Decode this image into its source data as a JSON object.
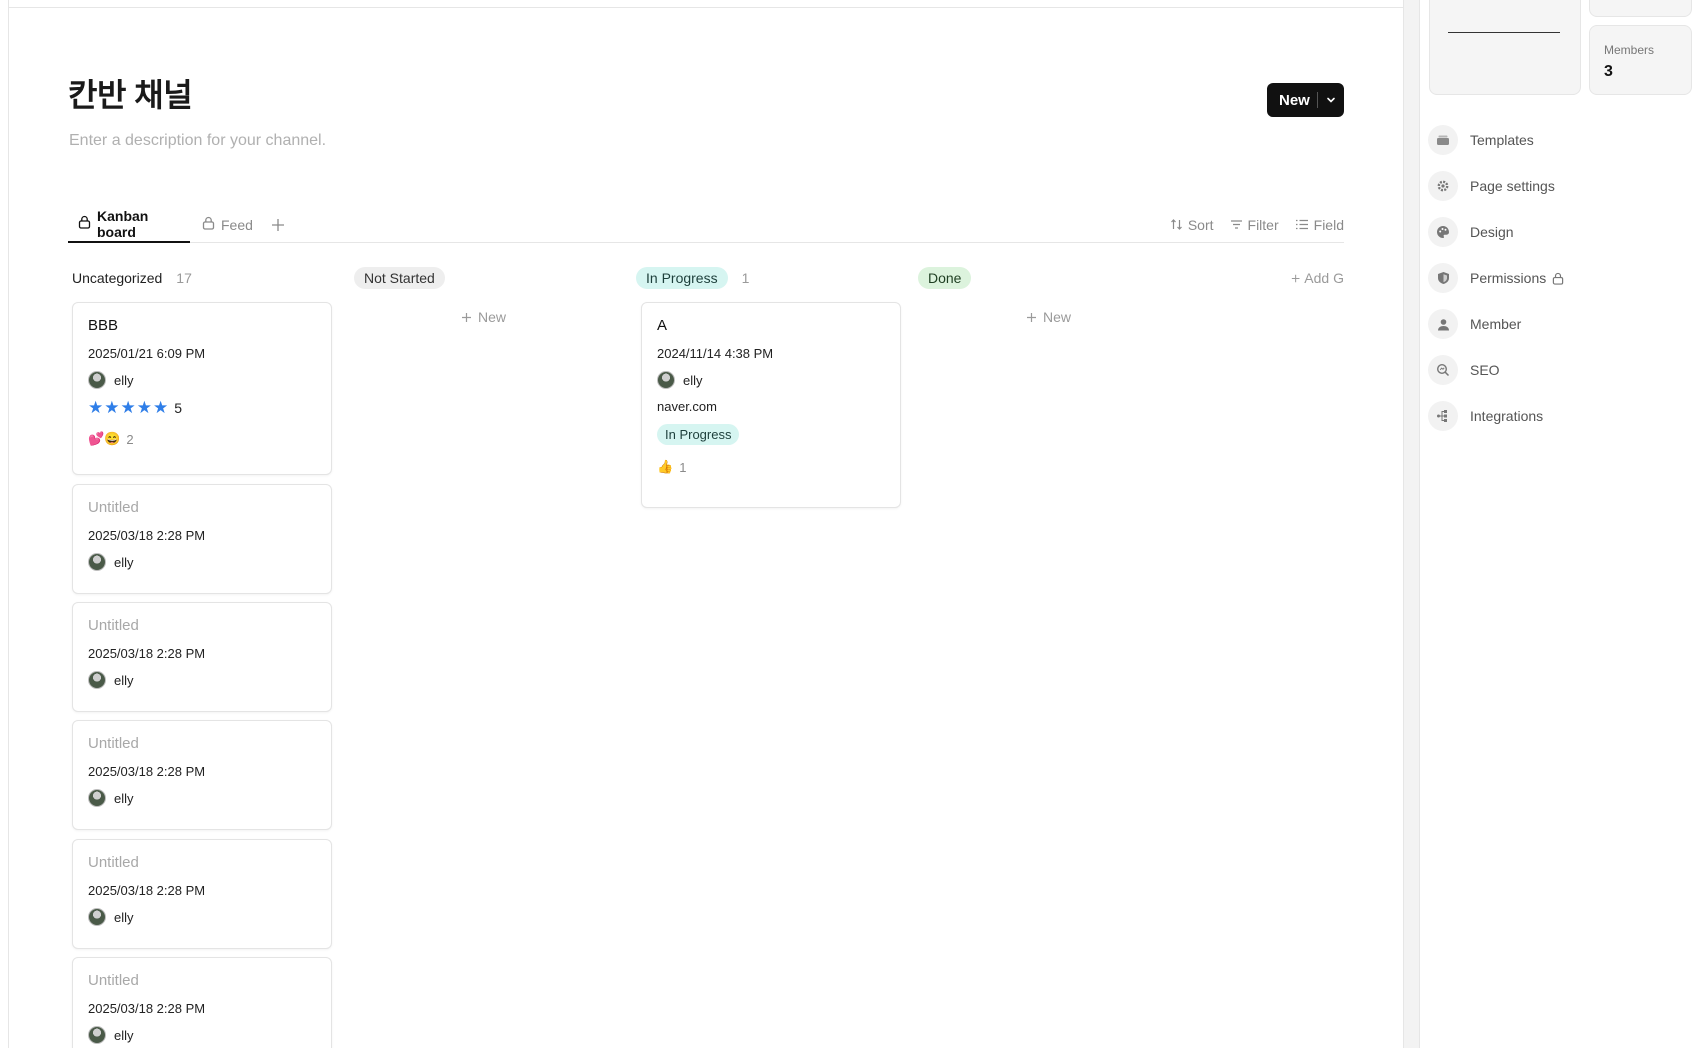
{
  "channel": {
    "title": "칸반 채널",
    "description_placeholder": "Enter a description for your channel."
  },
  "header": {
    "new_label": "New"
  },
  "tabs": [
    {
      "label": "Kanban board",
      "active": true,
      "icon": "lock-icon"
    },
    {
      "label": "Feed",
      "active": false,
      "icon": "lock-icon"
    }
  ],
  "toolbar": {
    "sort": "Sort",
    "filter": "Filter",
    "field": "Field"
  },
  "columns": {
    "uncategorized": {
      "label": "Uncategorized",
      "count": "17"
    },
    "not_started": {
      "label": "Not Started",
      "new_label": "New"
    },
    "in_progress": {
      "label": "In Progress",
      "count": "1"
    },
    "done": {
      "label": "Done",
      "new_label": "New"
    },
    "add_group": "Add G"
  },
  "cards": {
    "uncategorized": [
      {
        "title": "BBB",
        "date": "2025/01/21 6:09 PM",
        "user": "elly",
        "rating": "5",
        "reactions": "2"
      },
      {
        "title": "Untitled",
        "date": "2025/03/18 2:28 PM",
        "user": "elly"
      },
      {
        "title": "Untitled",
        "date": "2025/03/18 2:28 PM",
        "user": "elly"
      },
      {
        "title": "Untitled",
        "date": "2025/03/18 2:28 PM",
        "user": "elly"
      },
      {
        "title": "Untitled",
        "date": "2025/03/18 2:28 PM",
        "user": "elly"
      },
      {
        "title": "Untitled",
        "date": "2025/03/18 2:28 PM",
        "user": "elly"
      }
    ],
    "in_progress": [
      {
        "title": "A",
        "date": "2024/11/14 4:38 PM",
        "user": "elly",
        "link": "naver.com",
        "status": "In Progress",
        "reactions": "1"
      }
    ]
  },
  "sidebar": {
    "members_label": "Members",
    "members_value": "3",
    "menu": [
      {
        "label": "Templates",
        "icon": "template-icon"
      },
      {
        "label": "Page settings",
        "icon": "gear-icon"
      },
      {
        "label": "Design",
        "icon": "palette-icon"
      },
      {
        "label": "Permissions",
        "icon": "shield-icon"
      },
      {
        "label": "Member",
        "icon": "person-icon"
      },
      {
        "label": "SEO",
        "icon": "search-icon"
      },
      {
        "label": "Integrations",
        "icon": "integrations-icon"
      }
    ]
  },
  "colors": {
    "accent_dark": "#111111",
    "star": "#2f7ee8",
    "teal_pill": "#d6f5f1",
    "green_pill": "#dcf3dd",
    "gray_pill": "#eeeeee"
  }
}
